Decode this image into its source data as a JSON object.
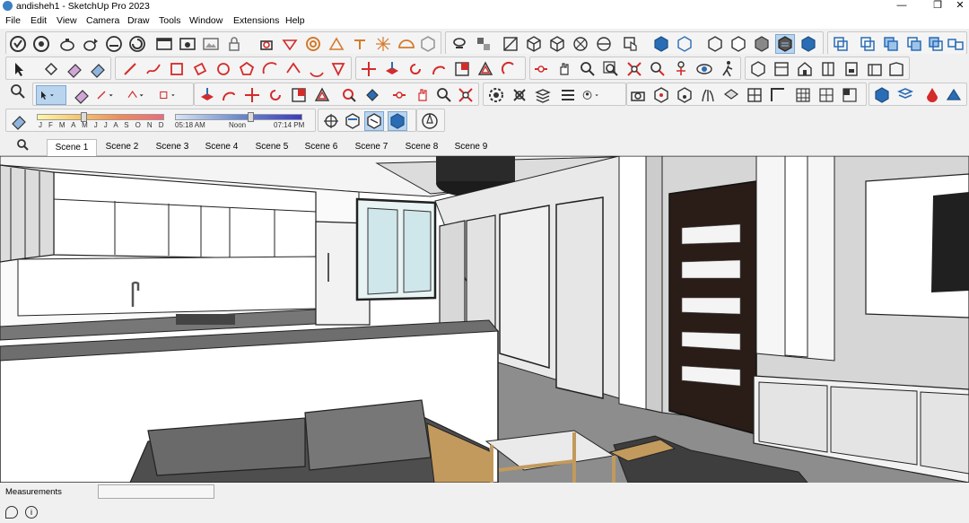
{
  "window": {
    "title": "andisheh1 - SketchUp Pro 2023",
    "minimize_glyph": "—",
    "maximize_glyph": "❐",
    "close_glyph": "✕"
  },
  "menu": [
    "File",
    "Edit",
    "View",
    "Camera",
    "Draw",
    "Tools",
    "Window",
    "Extensions",
    "Help"
  ],
  "shadows": {
    "months": "J F M A M J J A S O N D",
    "time_start": "05:18 AM",
    "time_noon": "Noon",
    "time_end": "07:14 PM"
  },
  "scenes": {
    "tabs": [
      "Scene 1",
      "Scene 2",
      "Scene 3",
      "Scene 4",
      "Scene 5",
      "Scene 6",
      "Scene 7",
      "Scene 8",
      "Scene 9"
    ],
    "active": "Scene 1"
  },
  "status": {
    "measurements_label": "Measurements",
    "measurements_value": "",
    "geo_icon": "location-icon",
    "info_icon": "info-icon"
  },
  "colors": {
    "accent": "#3b7fc4",
    "active_tool": "#b9d4ef",
    "icon_red": "#d42b2b",
    "icon_blue": "#2a6db5"
  }
}
